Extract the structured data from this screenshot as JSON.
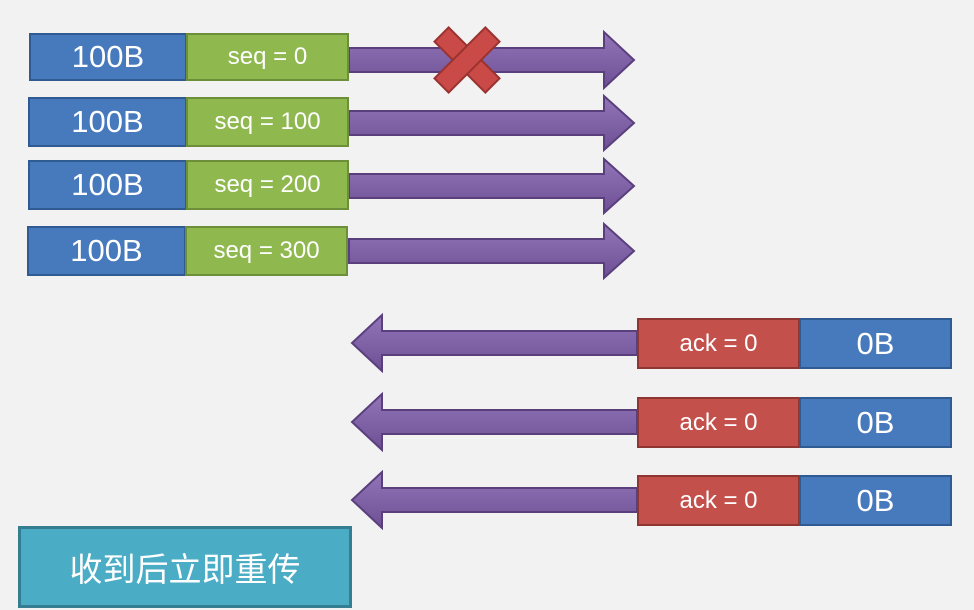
{
  "colors": {
    "size_box": "#4779bd",
    "seq_box": "#8fb84f",
    "ack_box": "#c4504c",
    "arrow": "#7e5fa4",
    "lost_mark": "#c94a47",
    "note_box": "#4bacc6"
  },
  "sent_segments": [
    {
      "size": "100B",
      "seq": "seq = 0",
      "lost": true
    },
    {
      "size": "100B",
      "seq": "seq = 100",
      "lost": false
    },
    {
      "size": "100B",
      "seq": "seq = 200",
      "lost": false
    },
    {
      "size": "100B",
      "seq": "seq = 300",
      "lost": false
    }
  ],
  "ack_segments": [
    {
      "ack": "ack = 0",
      "size": "0B"
    },
    {
      "ack": "ack = 0",
      "size": "0B"
    },
    {
      "ack": "ack = 0",
      "size": "0B"
    }
  ],
  "note": {
    "text": "收到后立即重传"
  },
  "icons": {
    "lost_mark": "x-mark-icon"
  }
}
